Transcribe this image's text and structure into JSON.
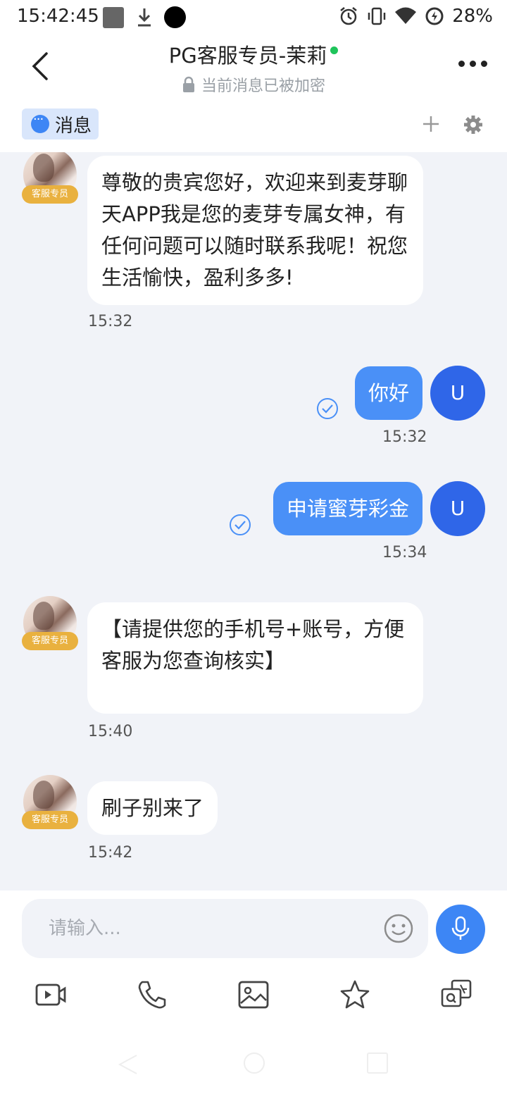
{
  "status_bar": {
    "time": "15:42:45",
    "battery": "28%",
    "icons": [
      "square-icon",
      "download-icon",
      "dot-icon",
      "alarm-icon",
      "vibrate-icon",
      "wifi-icon",
      "battery-saver-icon"
    ]
  },
  "header": {
    "title": "PG客服专员-茉莉",
    "subtitle": "当前消息已被加密",
    "online_color": "#1fc45b"
  },
  "tabs": {
    "active_label": "消息"
  },
  "messages": [
    {
      "side": "in",
      "badge": "客服专员",
      "text": "尊敬的贵宾您好，欢迎来到麦芽聊天APP我是您的麦芽专属女神，有任何问题可以随时联系我呢！祝您生活愉快，盈利多多!",
      "time": "15:32"
    },
    {
      "side": "out",
      "avatar": "U",
      "text": "你好",
      "time": "15:32"
    },
    {
      "side": "out",
      "avatar": "U",
      "text": "申请蜜芽彩金",
      "time": "15:34"
    },
    {
      "side": "in",
      "badge": "客服专员",
      "text": "【请提供您的手机号+账号，方便客服为您查询核实】",
      "time": "15:40"
    },
    {
      "side": "in",
      "badge": "客服专员",
      "text": "刷子别来了",
      "time": "15:42"
    }
  ],
  "composer": {
    "placeholder": "请输入...",
    "tools": [
      "video-call-icon",
      "phone-icon",
      "image-icon",
      "star-icon",
      "translate-icon"
    ]
  },
  "colors": {
    "accent": "#3d86f5",
    "bubble_out": "#4a90f7",
    "user_avatar": "#2f66e8",
    "badge": "#e9b13f",
    "chat_bg": "#f1f3f8"
  }
}
